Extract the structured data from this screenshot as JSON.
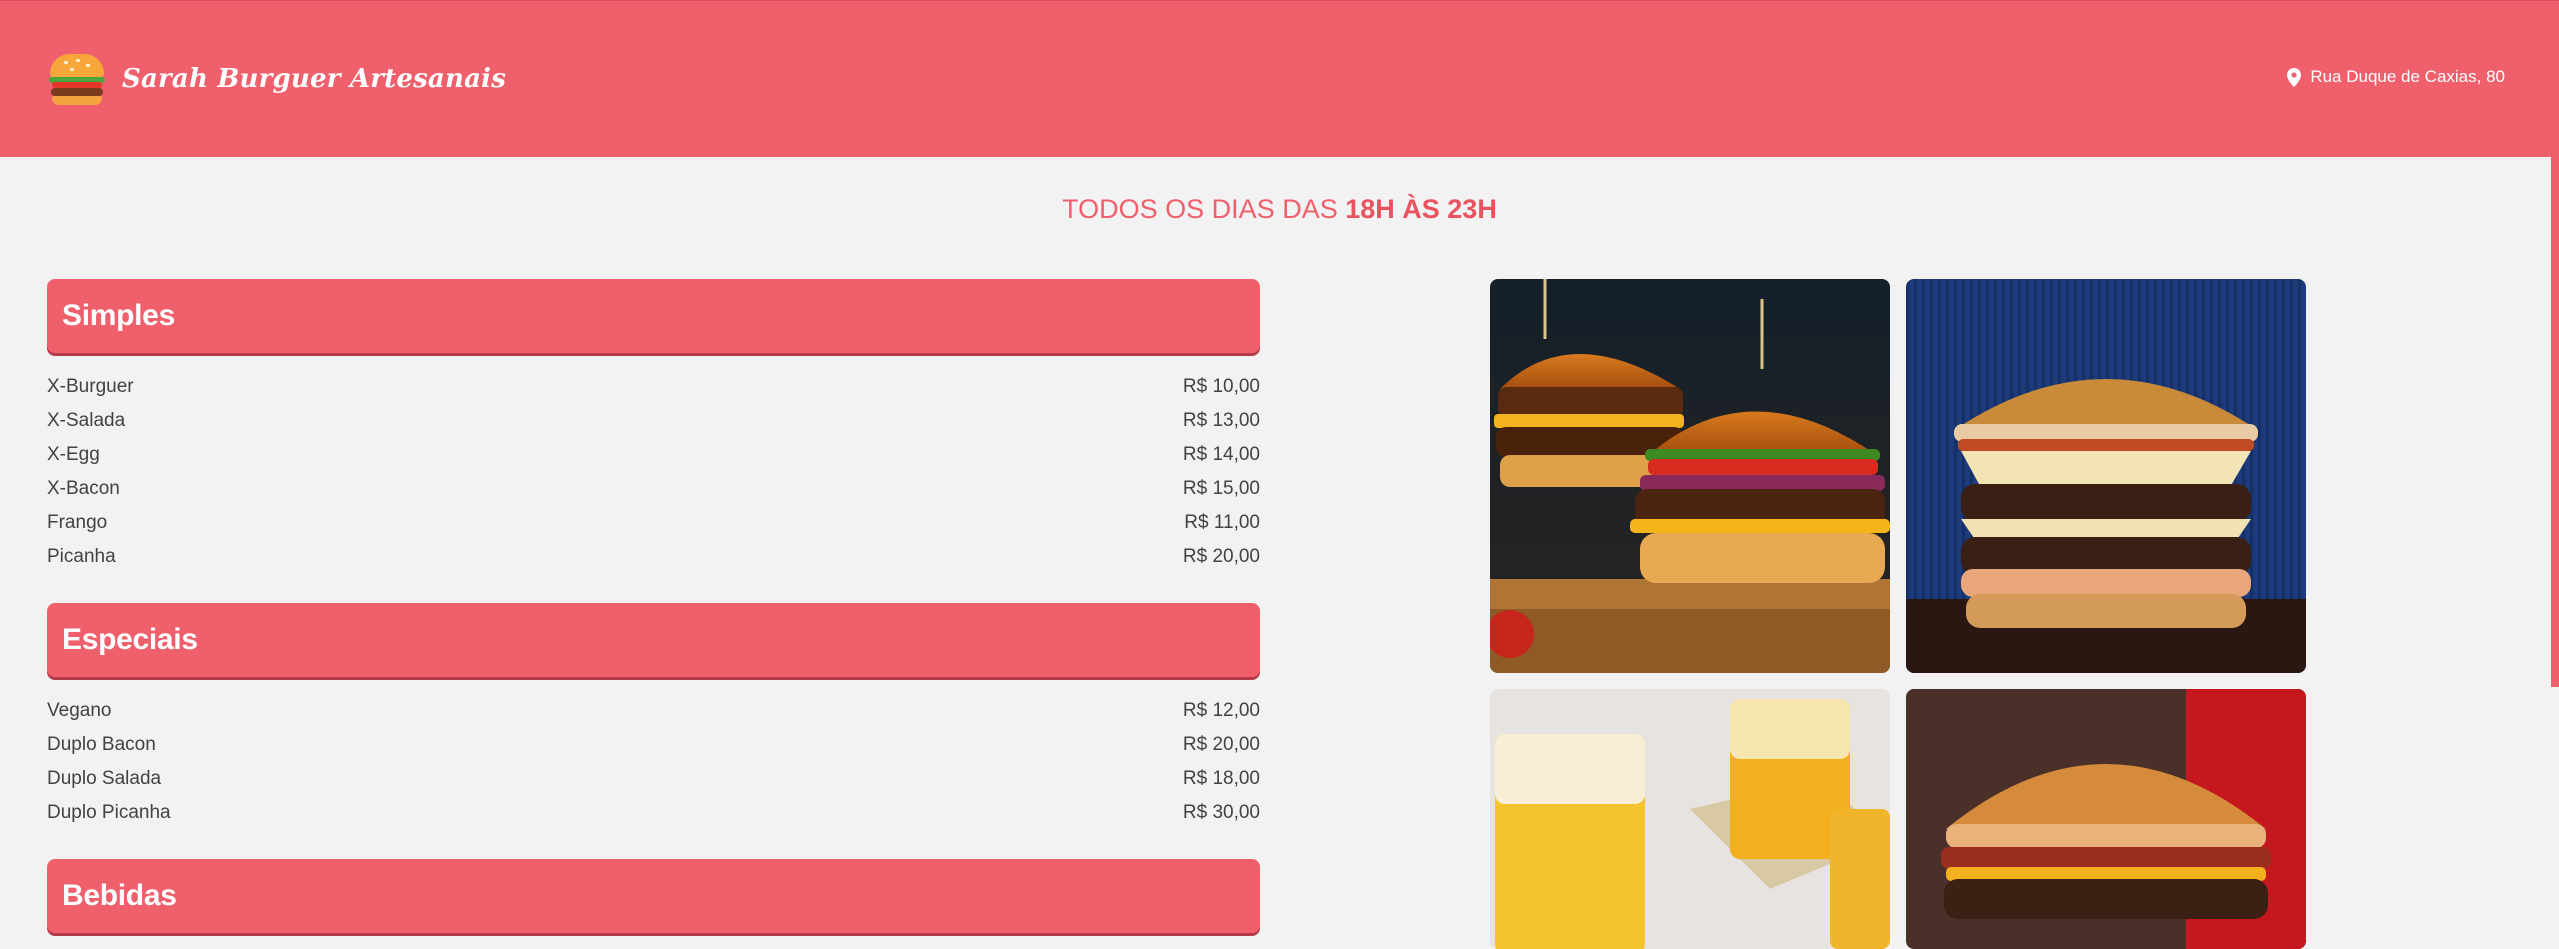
{
  "header": {
    "brand": "Sarah Burguer Artesanais",
    "address": "Rua Duque de Caxias, 80"
  },
  "hours": {
    "prefix": "TODOS OS DIAS DAS",
    "range": "18H ÀS 23H"
  },
  "menu": {
    "categories": [
      {
        "title": "Simples",
        "items": [
          {
            "name": "X-Burguer",
            "price": "R$ 10,00"
          },
          {
            "name": "X-Salada",
            "price": "R$ 13,00"
          },
          {
            "name": "X-Egg",
            "price": "R$ 14,00"
          },
          {
            "name": "X-Bacon",
            "price": "R$ 15,00"
          },
          {
            "name": "Frango",
            "price": "R$ 11,00"
          },
          {
            "name": "Picanha",
            "price": "R$ 20,00"
          }
        ]
      },
      {
        "title": "Especiais",
        "items": [
          {
            "name": "Vegano",
            "price": "R$ 12,00"
          },
          {
            "name": "Duplo Bacon",
            "price": "R$ 20,00"
          },
          {
            "name": "Duplo Salada",
            "price": "R$ 18,00"
          },
          {
            "name": "Duplo Picanha",
            "price": "R$ 30,00"
          }
        ]
      },
      {
        "title": "Bebidas",
        "items": []
      }
    ]
  },
  "colors": {
    "accent": "#f0606c",
    "background": "#f2f2f2",
    "text": "#424242"
  },
  "icons": {
    "logo": "burger-logo-icon",
    "address": "map-pin-icon"
  }
}
